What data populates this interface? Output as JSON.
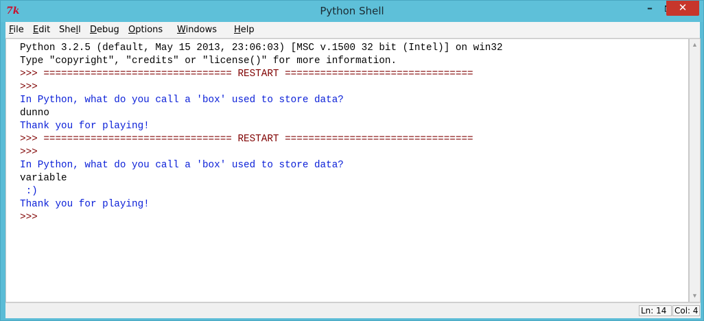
{
  "window": {
    "title": "Python Shell",
    "app_icon": "7k",
    "minimize": "–",
    "close": "✕"
  },
  "menu": [
    {
      "mnemonic": "F",
      "rest": "ile"
    },
    {
      "mnemonic": "E",
      "rest": "dit"
    },
    {
      "pre": "She",
      "mnemonic": "l",
      "rest": "l"
    },
    {
      "mnemonic": "D",
      "rest": "ebug"
    },
    {
      "mnemonic": "O",
      "rest": "ptions"
    },
    {
      "mnemonic": "W",
      "rest": "indows"
    },
    {
      "mnemonic": "H",
      "rest": "elp"
    }
  ],
  "shell": {
    "lines": [
      {
        "text": "Python 3.2.5 (default, May 15 2013, 23:06:03) [MSC v.1500 32 bit (Intel)] on win32",
        "color": "#000000"
      },
      {
        "text": "Type \"copyright\", \"credits\" or \"license()\" for more information.",
        "color": "#000000"
      },
      {
        "text": ">>> ================================ RESTART ================================",
        "color": "#7f0000"
      },
      {
        "text": ">>>",
        "color": "#7f0000"
      },
      {
        "text": "In Python, what do you call a 'box' used to store data?",
        "color": "#0b20d8"
      },
      {
        "text": "dunno",
        "color": "#000000"
      },
      {
        "text": "Thank you for playing!",
        "color": "#0b20d8"
      },
      {
        "text": ">>> ================================ RESTART ================================",
        "color": "#7f0000"
      },
      {
        "text": ">>>",
        "color": "#7f0000"
      },
      {
        "text": "In Python, what do you call a 'box' used to store data?",
        "color": "#0b20d8"
      },
      {
        "text": "variable",
        "color": "#000000"
      },
      {
        "text": " :)",
        "color": "#0b20d8"
      },
      {
        "text": "Thank you for playing!",
        "color": "#0b20d8"
      },
      {
        "text": ">>>",
        "color": "#7f0000"
      }
    ]
  },
  "status": {
    "ln": "Ln: 14",
    "col": "Col: 4"
  }
}
